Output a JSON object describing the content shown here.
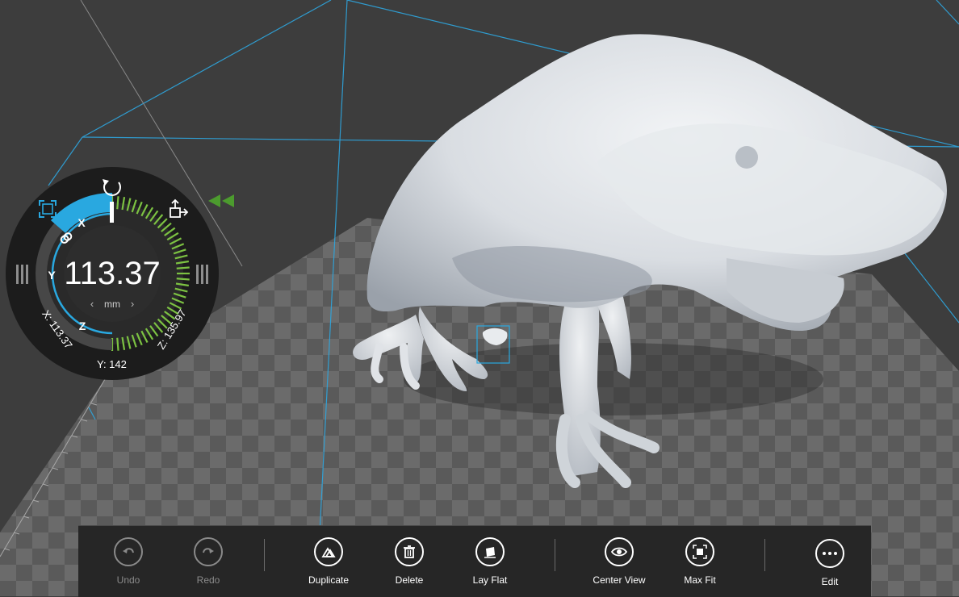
{
  "scale_tool": {
    "value": "113.37",
    "unit": "mm",
    "axes": {
      "x": "X",
      "y": "Y",
      "z": "Z"
    },
    "readouts": {
      "x": "X: 113.37",
      "y": "Y: 142",
      "z": "Z: 135.97"
    },
    "fill_fraction": 0.5,
    "uniform_scale_locked": true
  },
  "appbar": {
    "undo": "Undo",
    "redo": "Redo",
    "duplicate": "Duplicate",
    "delete": "Delete",
    "lay_flat": "Lay Flat",
    "center_view": "Center View",
    "max_fit": "Max Fit",
    "edit": "Edit"
  },
  "icons": {
    "undo": "undo-icon",
    "redo": "redo-icon",
    "duplicate": "duplicate-icon",
    "delete": "trash-icon",
    "lay_flat": "lay-flat-icon",
    "center_view": "eye-icon",
    "max_fit": "max-fit-icon",
    "edit": "more-icon",
    "rotate": "rotate-icon",
    "move": "move-icon",
    "scale": "scale-icon",
    "lock": "link-icon"
  },
  "colors": {
    "accent": "#29a8e0",
    "scale_green": "#7cc242",
    "background": "#3d3d3d",
    "appbar": "#262626"
  }
}
